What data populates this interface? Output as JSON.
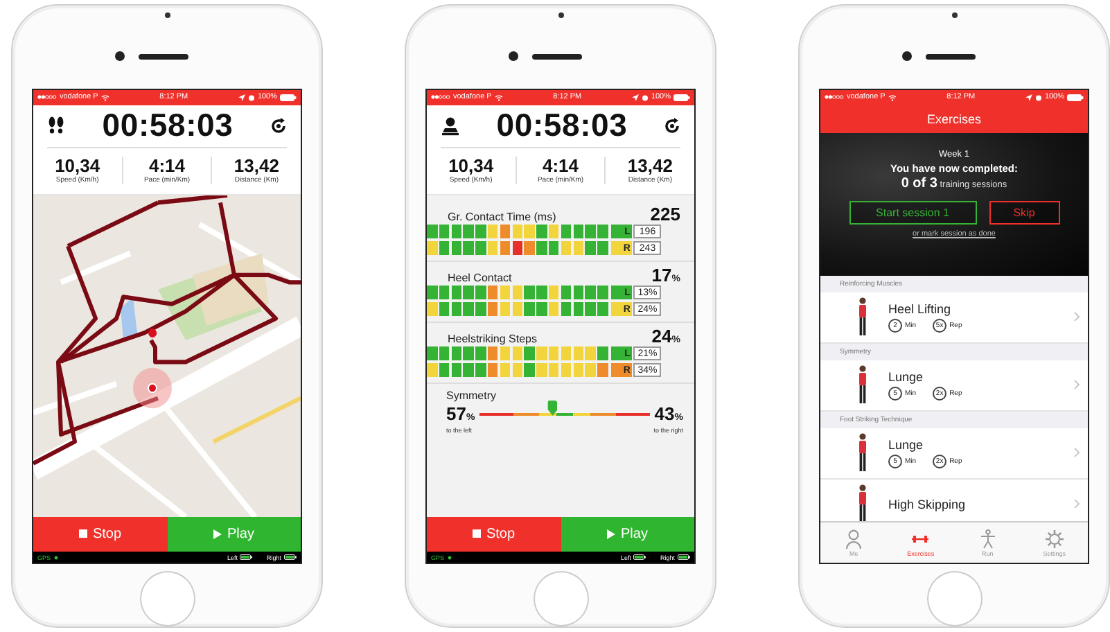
{
  "phones": [
    {
      "kind": "map",
      "status_bar": {
        "carrier": "vodafone P",
        "time": "8:12 PM",
        "battery": "100%"
      },
      "timer": {
        "kind": "footprints",
        "time": "00:58:03"
      },
      "stats": [
        {
          "value": "10,34",
          "label": "Speed (Km/h)"
        },
        {
          "value": "4:14",
          "label": "Pace (min/Km)"
        },
        {
          "value": "13,42",
          "label": "Distance (Km)"
        }
      ],
      "buttons": [
        {
          "kind": "stop",
          "label": "Stop"
        },
        {
          "kind": "play",
          "label": "Play"
        }
      ],
      "footer": {
        "gps": "GPS",
        "left": "Left",
        "right": "Right"
      }
    },
    {
      "kind": "metrics",
      "status_bar": {
        "carrier": "vodafone P",
        "time": "8:12 PM",
        "battery": "100%"
      },
      "timer": {
        "kind": "person",
        "time": "00:58:03"
      },
      "stats": [
        {
          "value": "10,34",
          "label": "Speed (Km/h)"
        },
        {
          "value": "4:14",
          "label": "Pace (min/Km)"
        },
        {
          "value": "13,42",
          "label": "Distance (Km)"
        }
      ],
      "metrics": [
        {
          "title": "Gr. Contact Time (ms)",
          "value": "225",
          "rows": [
            {
              "side": "L",
              "reading": "196",
              "color": "#35b335",
              "cells": [
                {
                  "color": "#35b335"
                },
                {
                  "color": "#35b335"
                },
                {
                  "color": "#35b335"
                },
                {
                  "color": "#35b335"
                },
                {
                  "color": "#35b335"
                },
                {
                  "color": "#f2d43c"
                },
                {
                  "color": "#ee8c2c"
                },
                {
                  "color": "#f2d43c"
                },
                {
                  "color": "#f2d43c"
                },
                {
                  "color": "#35b335"
                },
                {
                  "color": "#f2d43c"
                },
                {
                  "color": "#35b335"
                },
                {
                  "color": "#35b335"
                },
                {
                  "color": "#35b335"
                },
                {
                  "color": "#35b335"
                }
              ]
            },
            {
              "side": "R",
              "reading": "243",
              "color": "#f2d43c",
              "cells": [
                {
                  "color": "#f2d43c"
                },
                {
                  "color": "#35b335"
                },
                {
                  "color": "#35b335"
                },
                {
                  "color": "#35b335"
                },
                {
                  "color": "#35b335"
                },
                {
                  "color": "#f2d43c"
                },
                {
                  "color": "#ee8c2c"
                },
                {
                  "color": "#e8302a"
                },
                {
                  "color": "#ee8c2c"
                },
                {
                  "color": "#35b335"
                },
                {
                  "color": "#35b335"
                },
                {
                  "color": "#f2d43c"
                },
                {
                  "color": "#f2d43c"
                },
                {
                  "color": "#35b335"
                },
                {
                  "color": "#35b335"
                }
              ]
            }
          ]
        },
        {
          "title": "Heel Contact",
          "value": "17",
          "unit": "%",
          "rows": [
            {
              "side": "L",
              "reading": "13%",
              "color": "#35b335",
              "cells": [
                {
                  "color": "#35b335"
                },
                {
                  "color": "#35b335"
                },
                {
                  "color": "#35b335"
                },
                {
                  "color": "#35b335"
                },
                {
                  "color": "#35b335"
                },
                {
                  "color": "#ee8c2c"
                },
                {
                  "color": "#f2d43c"
                },
                {
                  "color": "#f2d43c"
                },
                {
                  "color": "#35b335"
                },
                {
                  "color": "#35b335"
                },
                {
                  "color": "#f2d43c"
                },
                {
                  "color": "#35b335"
                },
                {
                  "color": "#35b335"
                },
                {
                  "color": "#35b335"
                },
                {
                  "color": "#35b335"
                }
              ]
            },
            {
              "side": "R",
              "reading": "24%",
              "color": "#f2d43c",
              "cells": [
                {
                  "color": "#f2d43c"
                },
                {
                  "color": "#35b335"
                },
                {
                  "color": "#35b335"
                },
                {
                  "color": "#35b335"
                },
                {
                  "color": "#35b335"
                },
                {
                  "color": "#ee8c2c"
                },
                {
                  "color": "#f2d43c"
                },
                {
                  "color": "#f2d43c"
                },
                {
                  "color": "#35b335"
                },
                {
                  "color": "#35b335"
                },
                {
                  "color": "#f2d43c"
                },
                {
                  "color": "#35b335"
                },
                {
                  "color": "#35b335"
                },
                {
                  "color": "#35b335"
                },
                {
                  "color": "#35b335"
                }
              ]
            }
          ]
        },
        {
          "title": "Heelstriking Steps",
          "value": "24",
          "unit": "%",
          "rows": [
            {
              "side": "L",
              "reading": "21%",
              "color": "#35b335",
              "cells": [
                {
                  "color": "#35b335"
                },
                {
                  "color": "#35b335"
                },
                {
                  "color": "#35b335"
                },
                {
                  "color": "#35b335"
                },
                {
                  "color": "#35b335"
                },
                {
                  "color": "#ee8c2c"
                },
                {
                  "color": "#f2d43c"
                },
                {
                  "color": "#f2d43c"
                },
                {
                  "color": "#35b335"
                },
                {
                  "color": "#f2d43c"
                },
                {
                  "color": "#f2d43c"
                },
                {
                  "color": "#f2d43c"
                },
                {
                  "color": "#f2d43c"
                },
                {
                  "color": "#f2d43c"
                },
                {
                  "color": "#35b335"
                }
              ]
            },
            {
              "side": "R",
              "reading": "34%",
              "color": "#ee8c2c",
              "cells": [
                {
                  "color": "#f2d43c"
                },
                {
                  "color": "#35b335"
                },
                {
                  "color": "#35b335"
                },
                {
                  "color": "#35b335"
                },
                {
                  "color": "#35b335"
                },
                {
                  "color": "#ee8c2c"
                },
                {
                  "color": "#f2d43c"
                },
                {
                  "color": "#f2d43c"
                },
                {
                  "color": "#35b335"
                },
                {
                  "color": "#f2d43c"
                },
                {
                  "color": "#f2d43c"
                },
                {
                  "color": "#f2d43c"
                },
                {
                  "color": "#f2d43c"
                },
                {
                  "color": "#f2d43c"
                },
                {
                  "color": "#ee8c2c"
                }
              ]
            }
          ]
        }
      ],
      "symmetry": {
        "title": "Symmetry",
        "left_value": "57",
        "left_unit": "%",
        "left_caption": "to the left",
        "right_value": "43",
        "right_unit": "%",
        "right_caption": "to the right",
        "level": 0.43
      },
      "buttons": [
        {
          "kind": "stop",
          "label": "Stop"
        },
        {
          "kind": "play",
          "label": "Play"
        }
      ],
      "footer": {
        "gps": "GPS",
        "left": "Left",
        "right": "Right"
      }
    },
    {
      "kind": "exercises",
      "status_bar": {
        "carrier": "vodafone P",
        "time": "8:12 PM",
        "battery": "100%"
      },
      "title": "Exercises",
      "banner": {
        "week": "Week 1",
        "message": "You have now completed:",
        "count": "0 of 3",
        "caption": "training sessions",
        "start_button": "Start session 1",
        "skip_button": "Skip",
        "link": "or mark session as done"
      },
      "sections": [
        {
          "title": "Reinforcing Muscles",
          "items": [
            {
              "name": "Heel Lifting",
              "minutes": "2",
              "minutes_label": "Min",
              "reps": "5x",
              "reps_label": "Rep"
            }
          ]
        },
        {
          "title": "Symmetry",
          "items": [
            {
              "name": "Lunge",
              "minutes": "5",
              "minutes_label": "Min",
              "reps": "2x",
              "reps_label": "Rep"
            }
          ]
        },
        {
          "title": "Foot Striking Technique",
          "items": [
            {
              "name": "Lunge",
              "minutes": "5",
              "minutes_label": "Min",
              "reps": "2x",
              "reps_label": "Rep"
            },
            {
              "name": "High Skipping"
            }
          ]
        }
      ],
      "tabs": [
        {
          "kind": "person",
          "label": "Me",
          "selected": false
        },
        {
          "kind": "dumbbell",
          "label": "Exercises",
          "selected": true
        },
        {
          "kind": "runner",
          "label": "Run",
          "selected": false
        },
        {
          "kind": "gear",
          "label": "Settings",
          "selected": false
        }
      ]
    }
  ]
}
